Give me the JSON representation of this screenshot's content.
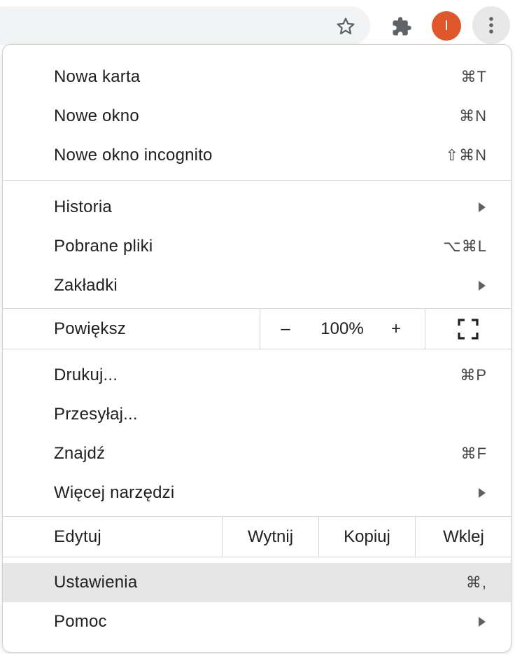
{
  "avatar_initial": "I",
  "colors": {
    "avatar": "#e0572b",
    "highlight": "#e6e6e6"
  },
  "menu": {
    "new_tab": {
      "label": "Nowa karta",
      "shortcut": "⌘T"
    },
    "new_window": {
      "label": "Nowe okno",
      "shortcut": "⌘N"
    },
    "incognito": {
      "label": "Nowe okno incognito",
      "shortcut": "⇧⌘N"
    },
    "history": {
      "label": "Historia"
    },
    "downloads": {
      "label": "Pobrane pliki",
      "shortcut": "⌥⌘L"
    },
    "bookmarks": {
      "label": "Zakładki"
    },
    "zoom": {
      "label": "Powiększ",
      "minus": "–",
      "value": "100%",
      "plus": "+"
    },
    "print": {
      "label": "Drukuj...",
      "shortcut": "⌘P"
    },
    "cast": {
      "label": "Przesyłaj..."
    },
    "find": {
      "label": "Znajdź",
      "shortcut": "⌘F"
    },
    "more_tools": {
      "label": "Więcej narzędzi"
    },
    "edit": {
      "label": "Edytuj",
      "cut": "Wytnij",
      "copy": "Kopiuj",
      "paste": "Wklej"
    },
    "settings": {
      "label": "Ustawienia",
      "shortcut": "⌘,"
    },
    "help": {
      "label": "Pomoc"
    }
  }
}
